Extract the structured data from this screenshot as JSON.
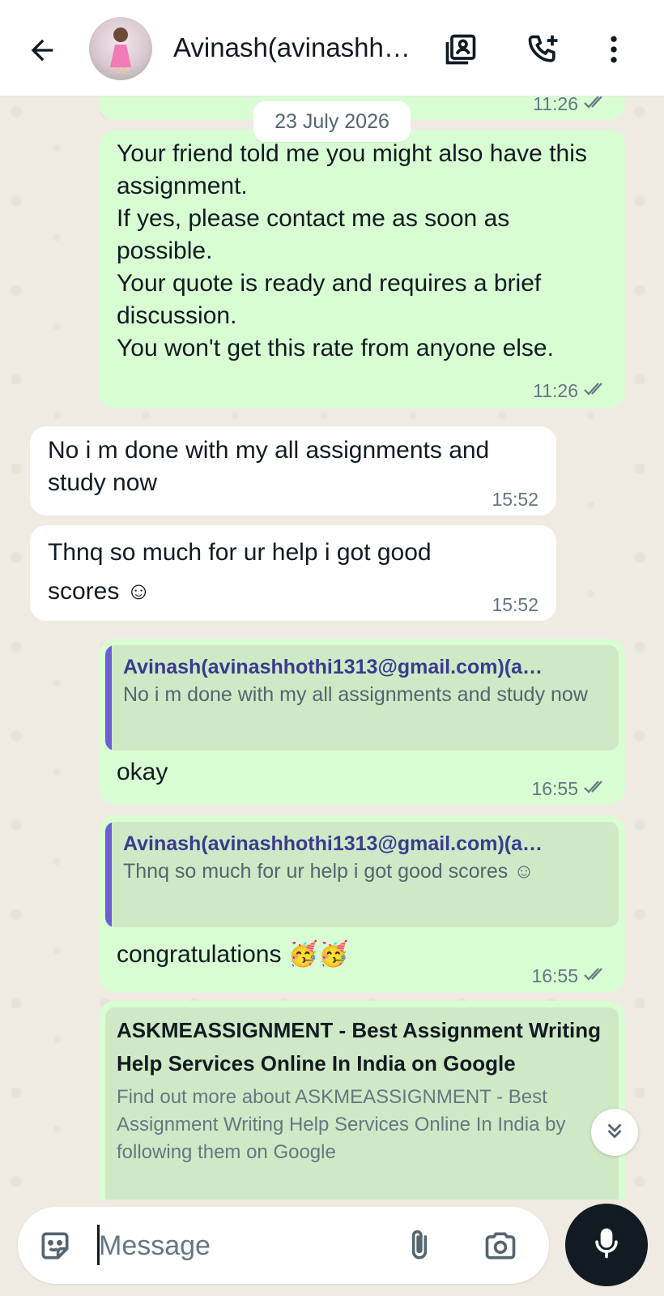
{
  "header": {
    "contact_name": "Avinash(avinashh…",
    "icons": [
      "back-arrow-icon",
      "contact-card-icon",
      "add-call-icon",
      "more-vert-icon"
    ]
  },
  "chat": {
    "date_chip": "23 July 2026",
    "top_partial_time": "11:26",
    "messages": [
      {
        "direction": "out",
        "text": "Your friend told me you might also have this assignment.\nIf yes, please contact me as soon as possible.\nYour quote is ready and requires a brief discussion.\nYou won't get this rate from anyone else.",
        "time": "11:26",
        "status": "read"
      },
      {
        "direction": "in",
        "text": "No i m done with my all assignments and study now",
        "time": "15:52"
      },
      {
        "direction": "in",
        "text": "Thnq so much for ur help i got good scores ☺",
        "time": "15:52"
      },
      {
        "direction": "out",
        "quote_author": "Avinash(avinashhothi1313@gmail.com)(a…",
        "quote_text": "No i m done with my all assignments and study now",
        "text": "okay",
        "time": "16:55",
        "status": "read"
      },
      {
        "direction": "out",
        "quote_author": "Avinash(avinashhothi1313@gmail.com)(a…",
        "quote_text": "Thnq so much for ur help i got good scores ☺",
        "text": "congratulations 🥳🥳",
        "time": "16:55",
        "status": "read"
      },
      {
        "direction": "out",
        "link_title": "ASKMEASSIGNMENT - Best Assignment Writing Help Services Online In India on Google",
        "link_desc": "Find out more about ASKMEASSIGNMENT - Best Assignment Writing Help Services Online In India by following them on Google"
      }
    ]
  },
  "composer": {
    "placeholder": "Message",
    "icons": [
      "sticker-icon",
      "attach-icon",
      "camera-icon",
      "mic-icon"
    ]
  },
  "colors": {
    "outgoing_bubble": "#d9fdd3",
    "incoming_bubble": "#ffffff",
    "chat_background": "#efeae2",
    "quote_bar": "#6b5fd3",
    "mic_button": "#111b21"
  }
}
